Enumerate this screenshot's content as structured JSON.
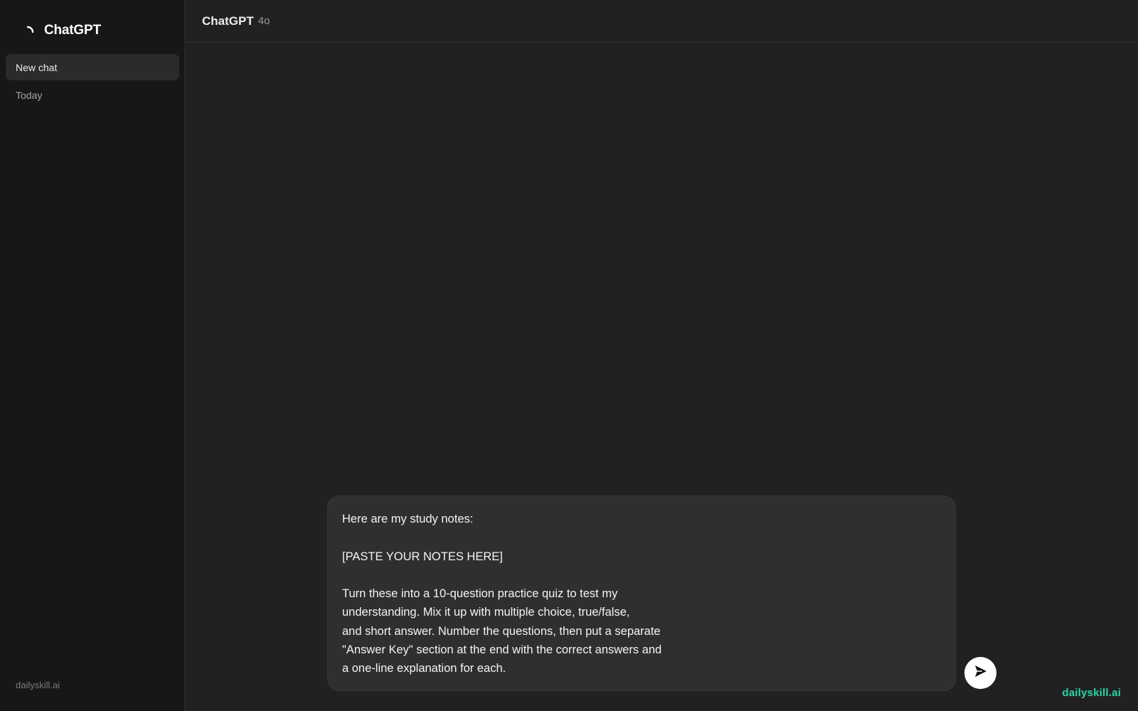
{
  "sidebar": {
    "brand_title": "ChatGPT",
    "logo_icon": "spinner-logo-icon",
    "new_chat_label": "New chat",
    "section_label": "Today",
    "footer_text": "dailyskill.ai"
  },
  "header": {
    "model_name": "ChatGPT",
    "model_version": "4o"
  },
  "composer": {
    "text": "Here are my study notes:\n\n[PASTE YOUR NOTES HERE]\n\nTurn these into a 10-question practice quiz to test my\nunderstanding. Mix it up with multiple choice, true/false,\nand short answer. Number the questions, then put a separate\n\"Answer Key\" section at the end with the correct answers and\na one-line explanation for each.",
    "send_icon": "send-arrow-icon"
  },
  "watermark": "dailyskill.ai",
  "colors": {
    "sidebar_bg": "#171717",
    "main_bg": "#212121",
    "composer_bg": "#2f2f2f",
    "accent": "#2dd4a7"
  }
}
